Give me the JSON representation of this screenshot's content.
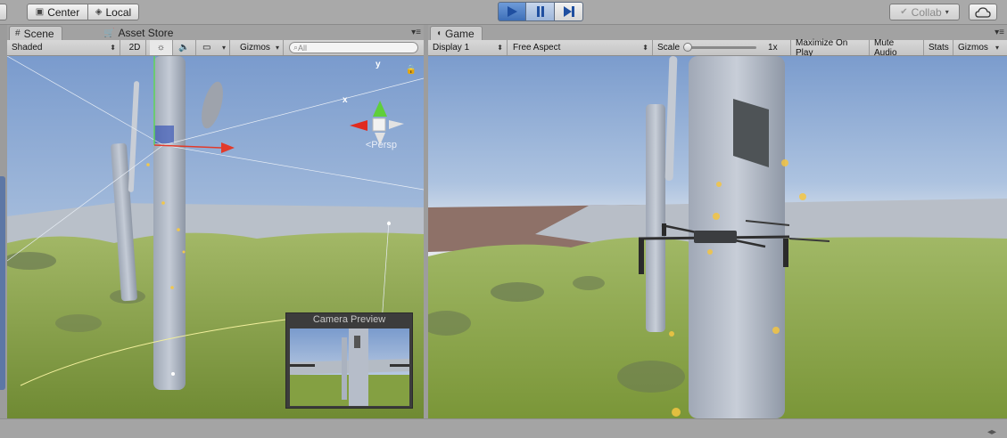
{
  "toolbar": {
    "center_label": "Center",
    "local_label": "Local",
    "collab_label": "Collab",
    "play_icon": "play-icon",
    "pause_icon": "pause-icon",
    "step_icon": "step-icon"
  },
  "scene": {
    "tabs": [
      {
        "label": "Scene",
        "icon": "grid-icon"
      },
      {
        "label": "Asset Store",
        "icon": "store-icon"
      }
    ],
    "shading_mode": "Shaded",
    "mode_2d": "2D",
    "gizmos_label": "Gizmos",
    "search_placeholder": "All",
    "persp_label": "Persp",
    "axis_x": "x",
    "axis_y": "y",
    "camera_preview_title": "Camera Preview"
  },
  "game": {
    "tab_label": "Game",
    "display": "Display 1",
    "aspect": "Free Aspect",
    "scale_label": "Scale",
    "scale_value": 0,
    "scale_value_label": "1x",
    "maximize_label": "Maximize On Play",
    "mute_label": "Mute Audio",
    "stats_label": "Stats",
    "gizmos_label": "Gizmos"
  },
  "colors": {
    "play_active": "#3d6fb8",
    "sky_top": "#7e9fd0",
    "ground": "#8ea84a",
    "pillar": "#b0b8c6"
  }
}
